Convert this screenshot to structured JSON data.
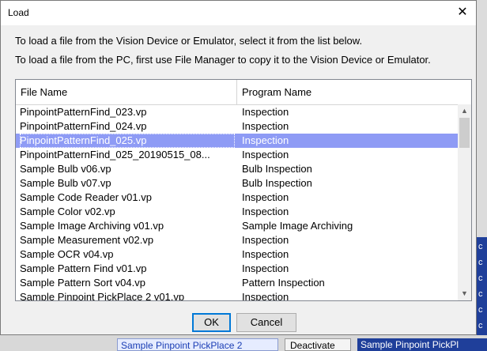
{
  "dialog": {
    "title": "Load",
    "close_glyph": "✕",
    "instruction_1": "To load a file from the Vision Device or Emulator, select it from the list below.",
    "instruction_2": "To load a file from the PC, first use File Manager to copy it to the Vision Device or Emulator."
  },
  "table": {
    "columns": [
      "File Name",
      "Program Name"
    ],
    "selected_index": 2,
    "rows": [
      {
        "file": "PinpointPatternFind_023.vp",
        "program": "Inspection"
      },
      {
        "file": "PinpointPatternFind_024.vp",
        "program": "Inspection"
      },
      {
        "file": "PinpointPatternFind_025.vp",
        "program": "Inspection"
      },
      {
        "file": "PinpointPatternFind_025_20190515_08...",
        "program": "Inspection"
      },
      {
        "file": "Sample Bulb v06.vp",
        "program": "Bulb Inspection"
      },
      {
        "file": "Sample Bulb v07.vp",
        "program": "Bulb Inspection"
      },
      {
        "file": "Sample Code Reader v01.vp",
        "program": "Inspection"
      },
      {
        "file": "Sample Color v02.vp",
        "program": "Inspection"
      },
      {
        "file": "Sample Image Archiving v01.vp",
        "program": "Sample Image Archiving"
      },
      {
        "file": "Sample Measurement v02.vp",
        "program": "Inspection"
      },
      {
        "file": "Sample OCR v04.vp",
        "program": "Inspection"
      },
      {
        "file": "Sample Pattern Find v01.vp",
        "program": "Inspection"
      },
      {
        "file": "Sample Pattern Sort v04.vp",
        "program": "Pattern Inspection"
      },
      {
        "file": "Sample Pinpoint PickPlace 2 v01.vp",
        "program": "Inspection"
      }
    ]
  },
  "buttons": {
    "ok": "OK",
    "cancel": "Cancel"
  },
  "background": {
    "bottom_1": "Sample Pinpoint PickPlace 2",
    "bottom_2": "Deactivate",
    "bottom_3": "Sample Pinpoint PickPl",
    "right_letters": [
      "c",
      "c",
      "c",
      "c",
      "c",
      "c",
      "c"
    ]
  },
  "colors": {
    "selection": "#8e9bf5",
    "accent": "#0078d7",
    "background_blue": "#1f3f9a"
  }
}
